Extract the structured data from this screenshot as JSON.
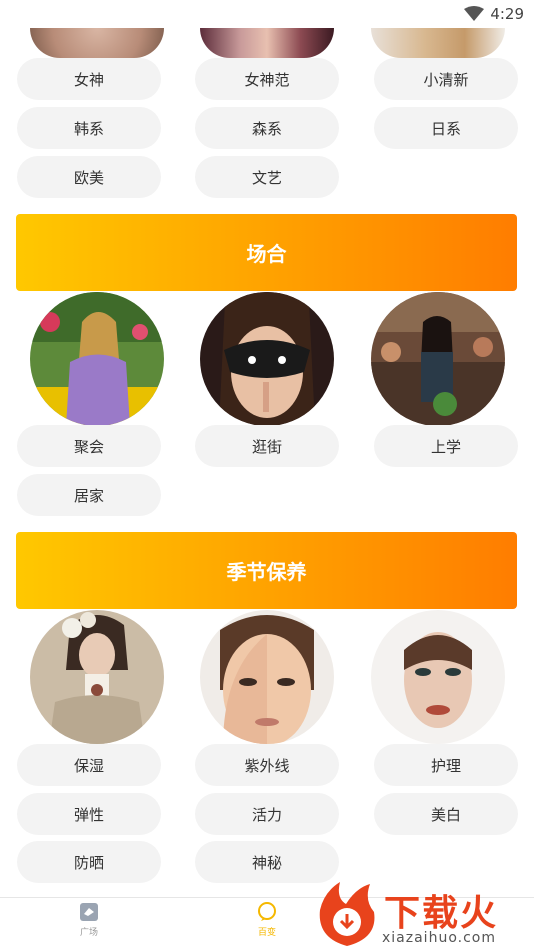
{
  "status_bar": {
    "time": "4:29"
  },
  "style_chips": [
    "女神",
    "女神范",
    "小清新",
    "韩系",
    "森系",
    "日系",
    "欧美",
    "文艺"
  ],
  "sections": [
    {
      "title": "场合",
      "photos": [
        "party-woman-photo",
        "masked-woman-photo",
        "cafe-woman-photo"
      ],
      "chips": [
        "聚会",
        "逛街",
        "上学",
        "居家"
      ]
    },
    {
      "title": "季节保养",
      "photos": [
        "flower-crown-woman-photo",
        "sunscreen-face-photo",
        "fur-hood-woman-photo"
      ],
      "chips": [
        "保湿",
        "紫外线",
        "护理",
        "弹性",
        "活力",
        "美白",
        "防晒",
        "神秘"
      ]
    }
  ],
  "bottom_nav": [
    {
      "label": "广场",
      "icon": "square-plaza-icon",
      "active": false
    },
    {
      "label": "百变",
      "icon": "chat-bubble-icon",
      "active": true
    }
  ],
  "watermark": {
    "text_cn": "下载火",
    "text_en": "xiazaihuo.com"
  },
  "colors": {
    "banner_start": "#ffc800",
    "banner_end": "#ff7d00",
    "chip_bg": "#f3f3f3",
    "active_nav": "#f5b800",
    "watermark": "#e8431c"
  }
}
